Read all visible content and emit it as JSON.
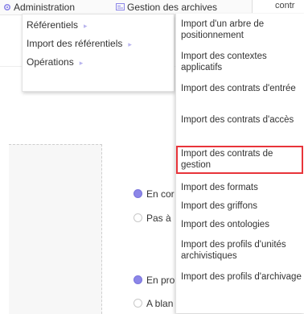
{
  "navbar": {
    "administration_label": "Administration",
    "gestion_label": "Gestion des archives",
    "search_text": "contr"
  },
  "menu": {
    "items": [
      {
        "label": "Référentiels"
      },
      {
        "label": "Import des référentiels"
      },
      {
        "label": "Opérations"
      }
    ],
    "arrow_glyph": "▸"
  },
  "submenu": {
    "items": [
      {
        "label": "Import d'un arbre de positionnement"
      },
      {
        "label": "Import des contextes applicatifs"
      },
      {
        "label": "Import des contrats d'entrée"
      },
      {
        "label": "Import des contrats d'accès"
      },
      {
        "label": "Import des contrats de gestion",
        "highlighted": true
      },
      {
        "label": "Import des formats"
      },
      {
        "label": "Import des griffons"
      },
      {
        "label": "Import des ontologies"
      },
      {
        "label": "Import des profils d'unités archivistiques"
      },
      {
        "label": "Import des profils d'archivage"
      }
    ]
  },
  "page": {
    "radios": [
      {
        "label": "En cor",
        "checked": true
      },
      {
        "label": "Pas à",
        "checked": false
      },
      {
        "label": "En pro",
        "checked": true
      },
      {
        "label": "A blan",
        "checked": false
      }
    ]
  },
  "colors": {
    "accent": "#8c86e8",
    "highlight_border": "#e8343a",
    "arrow": "#b9b5ee"
  },
  "icons": {
    "administration": "gear-icon",
    "gestion": "archive-icon"
  }
}
